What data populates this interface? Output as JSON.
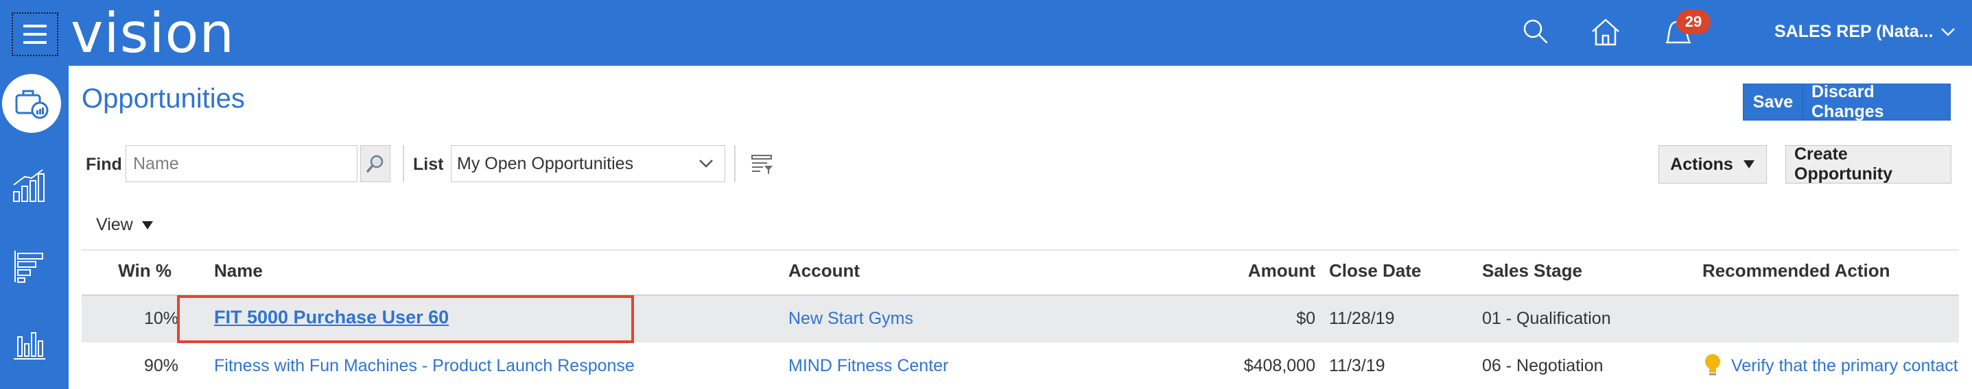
{
  "app": {
    "logo_text": "vision",
    "brand_color": "#2e74d3",
    "notifications_count": "29",
    "user_label": "SALES REP (Nata...",
    "icons": [
      "menu-icon",
      "search-icon",
      "home-icon",
      "notifications-icon",
      "chevron-down-icon"
    ]
  },
  "rail": {
    "items": [
      "opportunities-icon",
      "analytics-icon",
      "pipeline-icon",
      "reports-icon"
    ]
  },
  "page": {
    "title": "Opportunities",
    "save_label": "Save",
    "discard_label": "Discard Changes"
  },
  "toolbar": {
    "find_label": "Find",
    "find_placeholder": "Name",
    "list_label": "List",
    "list_value": "My Open Opportunities",
    "actions_label": "Actions",
    "create_label": "Create Opportunity",
    "view_label": "View"
  },
  "table": {
    "columns": {
      "win": "Win %",
      "name": "Name",
      "account": "Account",
      "amount": "Amount",
      "close_date": "Close Date",
      "sales_stage": "Sales Stage",
      "recommended": "Recommended Action"
    },
    "rows": [
      {
        "win": "10%",
        "name": "FIT 5000 Purchase User 60",
        "account": "New Start Gyms",
        "amount": "$0",
        "close_date": "11/28/19",
        "sales_stage": "01 - Qualification",
        "recommended": ""
      },
      {
        "win": "90%",
        "name": "Fitness with Fun Machines - Product Launch Response",
        "account": "MIND Fitness Center",
        "amount": "$408,000",
        "close_date": "11/3/19",
        "sales_stage": "06 - Negotiation",
        "recommended": "Verify that the primary contact"
      }
    ]
  },
  "colors": {
    "highlight": "#e0452f",
    "badge": "#d9442b",
    "selected_row": "#e9eaec"
  }
}
